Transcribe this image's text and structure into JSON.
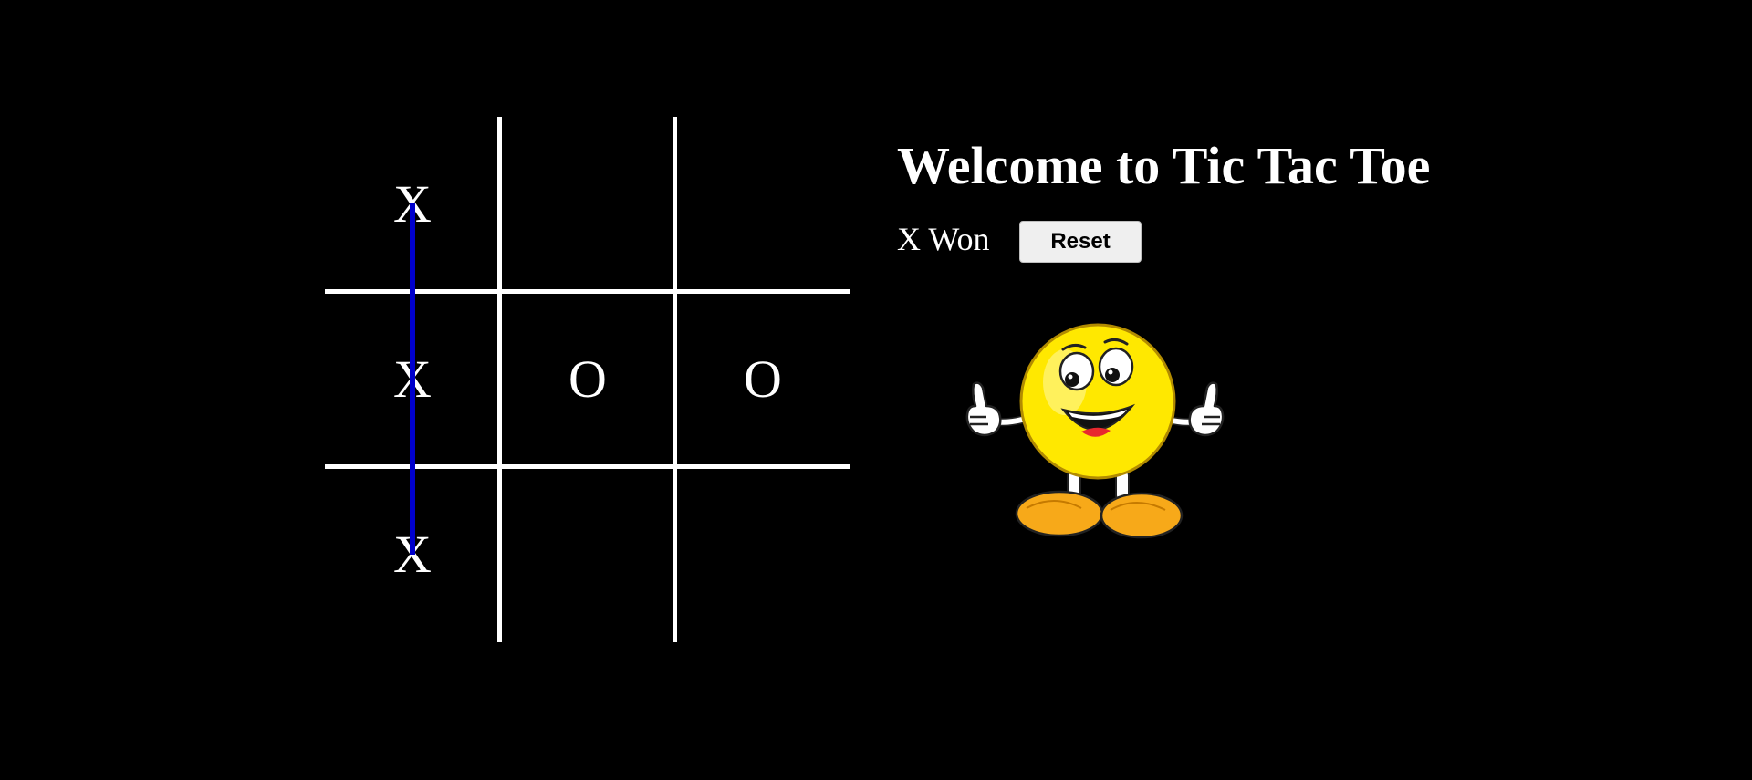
{
  "header": {
    "title": "Welcome to Tic Tac Toe"
  },
  "game": {
    "status": "X Won",
    "reset_label": "Reset",
    "cells": [
      "X",
      "",
      "",
      "X",
      "O",
      "O",
      "X",
      "",
      ""
    ],
    "win_line": {
      "orientation": "vertical",
      "column": 1,
      "color": "#0000cc"
    }
  },
  "colors": {
    "background": "#000000",
    "grid": "#ffffff",
    "text": "#ffffff",
    "mascot_face": "#ffe800",
    "mascot_shoes": "#f7a919"
  },
  "icons": {
    "mascot": "smiley-thumbs-up-icon"
  }
}
